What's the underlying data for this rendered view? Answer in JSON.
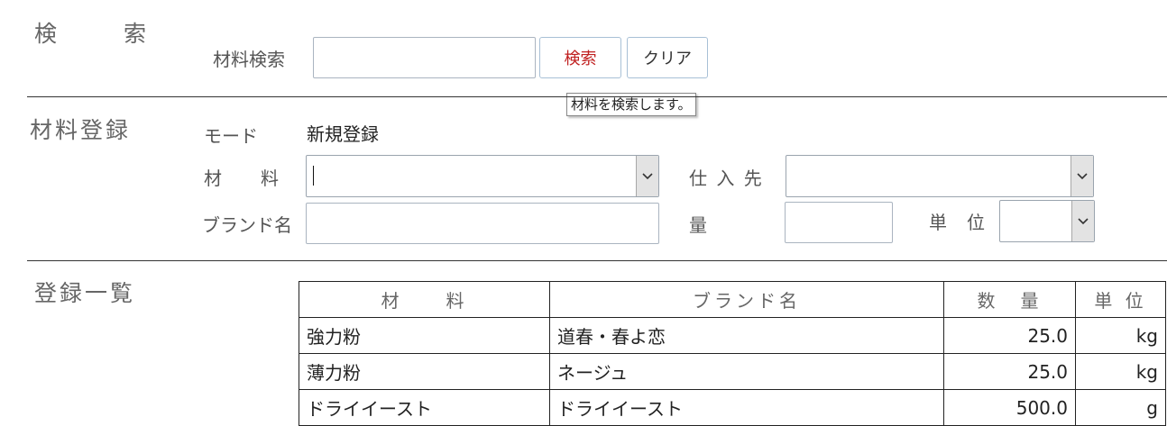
{
  "search": {
    "section_title": "検　　索",
    "material_label": "材料検索",
    "input_value": "",
    "search_button": "検索",
    "clear_button": "クリア",
    "tooltip": "材料を検索します。",
    "colors": {
      "search_button_text": "#c02020",
      "clear_button_text": "#333333"
    }
  },
  "register": {
    "section_title": "材料登録",
    "mode_label": "モード",
    "mode_value": "新規登録",
    "material_label": "材　　料",
    "material_value": "",
    "supplier_label": "仕 入 先",
    "supplier_value": "",
    "brand_label": "ブランド名",
    "brand_value": "",
    "quantity_label": "量",
    "quantity_value": "",
    "unit_label": "単　位",
    "unit_value": "",
    "dropdown_icon": "chevron-down-icon"
  },
  "list": {
    "section_title": "登録一覧",
    "headers": [
      "材　　料",
      "ブランド名",
      "数　量",
      "単 位"
    ],
    "rows": [
      [
        "強力粉",
        "道春・春よ恋",
        "25.0",
        "kg"
      ],
      [
        "薄力粉",
        "ネージュ",
        "25.0",
        "kg"
      ],
      [
        "ドライイースト",
        "ドライイースト",
        "500.0",
        "g"
      ]
    ]
  }
}
